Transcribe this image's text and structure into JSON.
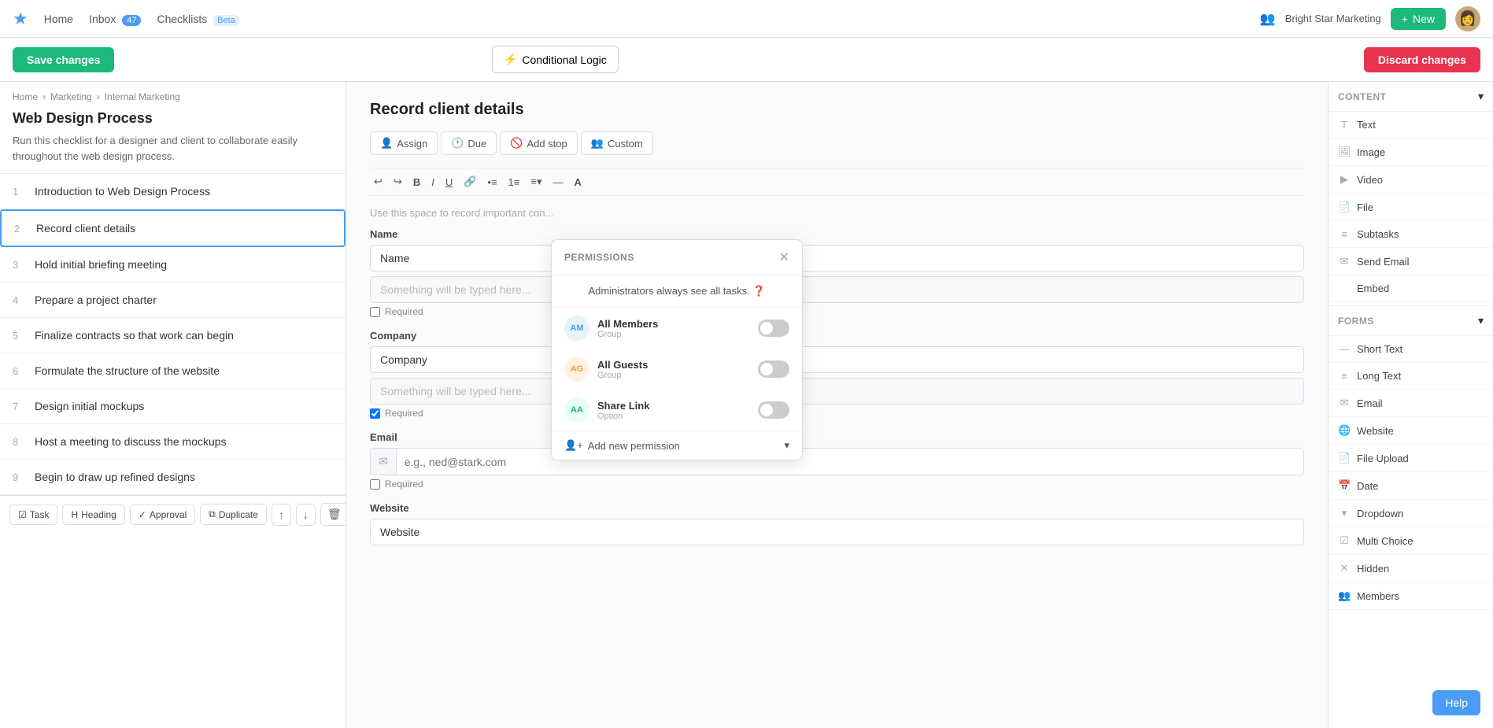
{
  "nav": {
    "home_label": "Home",
    "inbox_label": "Inbox",
    "inbox_count": "47",
    "checklists_label": "Checklists",
    "checklists_badge": "Beta",
    "org_name": "Bright Star Marketing",
    "new_label": "New"
  },
  "toolbar": {
    "save_label": "Save changes",
    "conditional_logic_label": "Conditional Logic",
    "discard_label": "Discard changes"
  },
  "breadcrumb": {
    "home": "Home",
    "marketing": "Marketing",
    "internal": "Internal Marketing"
  },
  "page": {
    "title": "Web Design Process",
    "description": "Run this checklist for a designer and client to collaborate easily throughout the web design process."
  },
  "tasks": [
    {
      "num": "1",
      "text": "Introduction to Web Design Process",
      "active": false
    },
    {
      "num": "2",
      "text": "Record client details",
      "active": true
    },
    {
      "num": "3",
      "text": "Hold initial briefing meeting",
      "active": false
    },
    {
      "num": "4",
      "text": "Prepare a project charter",
      "active": false
    },
    {
      "num": "5",
      "text": "Finalize contracts so that work can begin",
      "active": false
    },
    {
      "num": "6",
      "text": "Formulate the structure of the website",
      "active": false
    },
    {
      "num": "7",
      "text": "Design initial mockups",
      "active": false
    },
    {
      "num": "8",
      "text": "Host a meeting to discuss the mockups",
      "active": false
    },
    {
      "num": "9",
      "text": "Begin to draw up refined designs",
      "active": false
    }
  ],
  "bottom_toolbar": {
    "task_label": "Task",
    "heading_label": "Heading",
    "approval_label": "Approval",
    "duplicate_label": "Duplicate"
  },
  "center": {
    "task_title": "Record client details",
    "assign_label": "Assign",
    "due_label": "Due",
    "add_stop_label": "Add stop",
    "custom_label": "Custom",
    "editor_placeholder": "Use this space to record important con...",
    "fields": [
      {
        "id": "name",
        "label": "Name",
        "placeholder": "Something will be typed here...",
        "required": false
      },
      {
        "id": "company",
        "label": "Company",
        "placeholder": "Something will be typed here...",
        "required": true
      },
      {
        "id": "email",
        "label": "Email",
        "email_placeholder": "e.g., ned@stark.com",
        "required": true
      },
      {
        "id": "website",
        "label": "Website",
        "placeholder": "",
        "required": false
      }
    ]
  },
  "permissions_modal": {
    "title": "PERMISSIONS",
    "info_text": "Administrators always see all tasks.",
    "rows": [
      {
        "avatar_text": "AM",
        "name": "All Members",
        "sub": "Group",
        "avatar_class": "perm-am",
        "enabled": false
      },
      {
        "avatar_text": "AG",
        "name": "All Guests",
        "sub": "Group",
        "avatar_class": "perm-ag",
        "enabled": false
      },
      {
        "avatar_text": "AA",
        "name": "Share Link",
        "sub": "Option",
        "avatar_class": "perm-aa",
        "enabled": false
      }
    ],
    "add_label": "Add new permission"
  },
  "right_panel": {
    "content_section": "CONTENT",
    "content_items": [
      {
        "icon": "T",
        "label": "Text"
      },
      {
        "icon": "🖼",
        "label": "Image"
      },
      {
        "icon": "▶",
        "label": "Video"
      },
      {
        "icon": "📄",
        "label": "File"
      },
      {
        "icon": "≡",
        "label": "Subtasks"
      },
      {
        "icon": "✉",
        "label": "Send Email"
      },
      {
        "icon": "</>",
        "label": "Embed"
      }
    ],
    "forms_section": "FORMS",
    "forms_items": [
      {
        "icon": "—",
        "label": "Short Text"
      },
      {
        "icon": "≡",
        "label": "Long Text"
      },
      {
        "icon": "✉",
        "label": "Email"
      },
      {
        "icon": "🌐",
        "label": "Website"
      },
      {
        "icon": "📄",
        "label": "File Upload"
      },
      {
        "icon": "📅",
        "label": "Date"
      },
      {
        "icon": "▾",
        "label": "Dropdown"
      },
      {
        "icon": "☑",
        "label": "Multi Choice"
      },
      {
        "icon": "✕",
        "label": "Hidden"
      },
      {
        "icon": "👥",
        "label": "Members"
      }
    ]
  },
  "help_label": "Help"
}
